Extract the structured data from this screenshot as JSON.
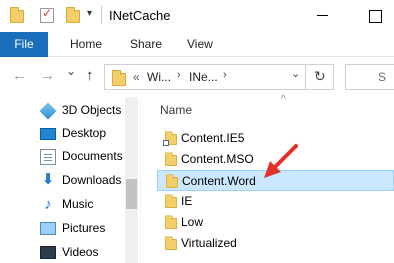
{
  "window": {
    "title": "INetCache",
    "qa_arrow": "▾",
    "controls": {
      "minimize": "",
      "maximize": ""
    }
  },
  "ribbon": {
    "tabs": [
      {
        "label": "File"
      },
      {
        "label": "Home"
      },
      {
        "label": "Share"
      },
      {
        "label": "View"
      }
    ]
  },
  "address": {
    "back_icon": "←",
    "forward_icon": "→",
    "recent_icon": "⌄",
    "up_icon": "↑",
    "overflow": "«",
    "crumbs": [
      "Wi...",
      "INe..."
    ],
    "chevron": "›",
    "dropdown": "⌄",
    "refresh_icon": "↻",
    "search_icon": "⌕",
    "search_placeholder": "S"
  },
  "nav": {
    "items": [
      {
        "label": "3D Objects",
        "icon": "cube-icon"
      },
      {
        "label": "Desktop",
        "icon": "desktop-icon"
      },
      {
        "label": "Documents",
        "icon": "documents-icon"
      },
      {
        "label": "Downloads",
        "icon": "download-icon"
      },
      {
        "label": "Music",
        "icon": "music-icon"
      },
      {
        "label": "Pictures",
        "icon": "pictures-icon"
      },
      {
        "label": "Videos",
        "icon": "videos-icon"
      }
    ],
    "download_glyph": "⬇",
    "music_glyph": "♪"
  },
  "content": {
    "column_header": "Name",
    "sort_caret": "^",
    "files": [
      {
        "name": "Content.IE5",
        "shortcut": true,
        "selected": false
      },
      {
        "name": "Content.MSO",
        "shortcut": false,
        "selected": false
      },
      {
        "name": "Content.Word",
        "shortcut": false,
        "selected": true
      },
      {
        "name": "IE",
        "shortcut": false,
        "selected": false
      },
      {
        "name": "Low",
        "shortcut": false,
        "selected": false
      },
      {
        "name": "Virtualized",
        "shortcut": false,
        "selected": false
      }
    ]
  },
  "colors": {
    "file_tab": "#1a6fbd",
    "selection_fill": "#cce8ff",
    "selection_border": "#99d1ff",
    "folder": "#f3cf6b",
    "annotation_arrow": "#e0342a"
  }
}
